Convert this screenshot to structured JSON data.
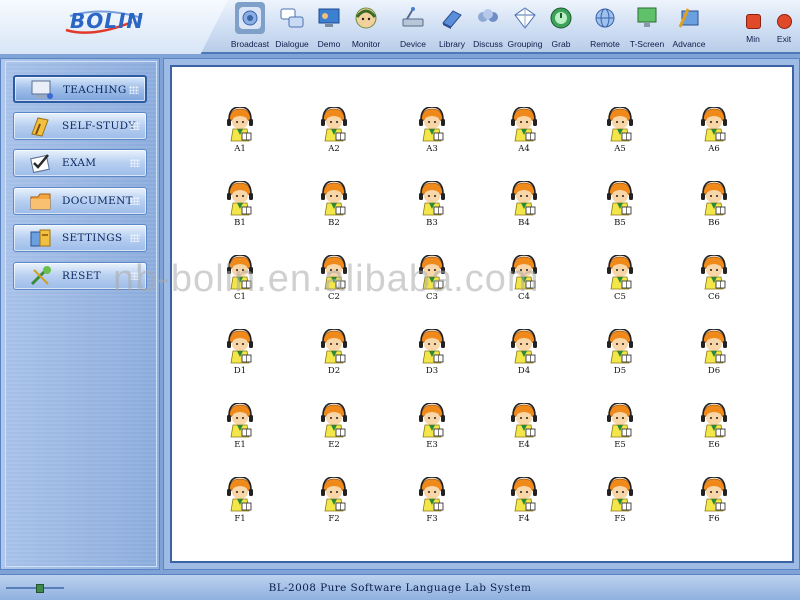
{
  "app": {
    "logo": "BOLIN",
    "status_bar": "BL-2008 Pure Software Language Lab System",
    "watermark": "nb-bolin.en.alibaba.com"
  },
  "toolbar": {
    "items": [
      {
        "label": "Broadcast",
        "icon": "broadcast-icon",
        "active": true
      },
      {
        "label": "Dialogue",
        "icon": "dialogue-icon"
      },
      {
        "label": "Demo",
        "icon": "demo-icon"
      },
      {
        "label": "Monitor",
        "icon": "monitor-icon"
      },
      {
        "label": "Device",
        "icon": "device-icon"
      },
      {
        "label": "Library",
        "icon": "library-icon"
      },
      {
        "label": "Discuss",
        "icon": "discuss-icon"
      },
      {
        "label": "Grouping",
        "icon": "grouping-icon"
      },
      {
        "label": "Grab",
        "icon": "grab-icon"
      },
      {
        "label": "Remote",
        "icon": "remote-icon"
      },
      {
        "label": "T-Screen",
        "icon": "t-screen-icon"
      },
      {
        "label": "Advance",
        "icon": "advance-icon"
      }
    ],
    "min_label": "Min",
    "exit_label": "Exit"
  },
  "sidebar": {
    "items": [
      {
        "label": "TEACHING",
        "icon": "teaching-icon",
        "active": true
      },
      {
        "label": "SELF-STUDY",
        "icon": "self-study-icon"
      },
      {
        "label": "EXAM",
        "icon": "exam-icon"
      },
      {
        "label": "DOCUMENT",
        "icon": "document-icon"
      },
      {
        "label": "SETTINGS",
        "icon": "settings-icon"
      },
      {
        "label": "RESET",
        "icon": "reset-icon"
      }
    ]
  },
  "seats": {
    "rows": [
      [
        "A1",
        "A2",
        "A3",
        "A4",
        "A5",
        "A6"
      ],
      [
        "B1",
        "B2",
        "B3",
        "B4",
        "B5",
        "B6"
      ],
      [
        "C1",
        "C2",
        "C3",
        "C4",
        "C5",
        "C6"
      ],
      [
        "D1",
        "D2",
        "D3",
        "D4",
        "D5",
        "D6"
      ],
      [
        "E1",
        "E2",
        "E3",
        "E4",
        "E5",
        "E6"
      ],
      [
        "F1",
        "F2",
        "F3",
        "F4",
        "F5",
        "F6"
      ]
    ]
  },
  "colors": {
    "accent": "#2a66c4",
    "seat_hair": "#f08a1a",
    "seat_headphone": "#222222"
  }
}
